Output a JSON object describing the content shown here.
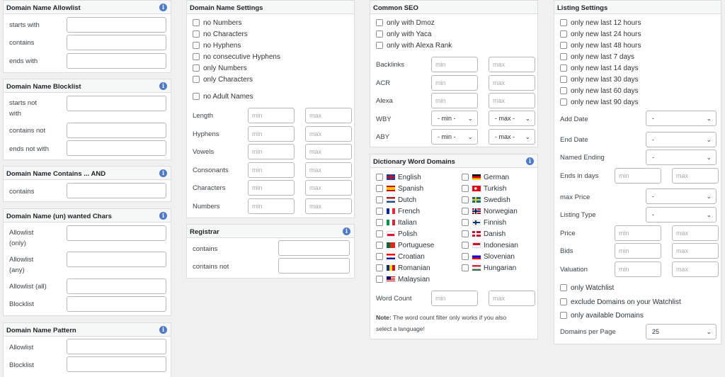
{
  "allowlist": {
    "title": "Domain Name Allowlist",
    "starts": "starts with",
    "contains": "contains",
    "ends": "ends with"
  },
  "blocklist": {
    "title": "Domain Name Blocklist",
    "starts_a": "starts not",
    "starts_b": "with",
    "contains": "contains not",
    "ends": "ends not with"
  },
  "contains_and": {
    "title": "Domain Name Contains ... AND",
    "contains": "contains"
  },
  "wanted_chars": {
    "title": "Domain Name (un) wanted Chars",
    "allow_only_a": "Allowlist",
    "allow_only_b": "(only)",
    "allow_any_a": "Allowlist",
    "allow_any_b": "(any)",
    "allow_all": "Allowlist (all)",
    "block": "Blocklist"
  },
  "pattern": {
    "title": "Domain Name Pattern",
    "allow": "Allowlist",
    "block": "Blocklist"
  },
  "settings": {
    "title": "Domain Name Settings",
    "checks": [
      "no Numbers",
      "no Characters",
      "no Hyphens",
      "no consecutive Hyphens",
      "only Numbers",
      "only Characters"
    ],
    "adult": "no Adult Names",
    "ranges": [
      "Length",
      "Hyphens",
      "Vowels",
      "Consonants",
      "Characters",
      "Numbers"
    ]
  },
  "registrar": {
    "title": "Registrar",
    "contains": "contains",
    "contains_not": "contains not"
  },
  "seo": {
    "title": "Common SEO",
    "checks": [
      "only with Dmoz",
      "only with Yaca",
      "only with Alexa Rank"
    ],
    "ranges": [
      "Backlinks",
      "ACR",
      "Alexa"
    ],
    "selects": [
      "WBY",
      "ABY"
    ],
    "min_opt": "- min -",
    "max_opt": "- max -"
  },
  "dictionary": {
    "title": "Dictionary Word Domains",
    "left": [
      "English",
      "Spanish",
      "Dutch",
      "French",
      "Italian",
      "Polish",
      "Portuguese",
      "Croatian",
      "Romanian",
      "Malaysian"
    ],
    "right": [
      "German",
      "Turkish",
      "Swedish",
      "Norwegian",
      "Finnish",
      "Danish",
      "Indonesian",
      "Slovenian",
      "Hungarian"
    ],
    "word_count": "Word Count",
    "note_bold": "Note:",
    "note_a": "The word count filter only works if you also",
    "note_b": "select a language!"
  },
  "listing": {
    "title": "Listing Settings",
    "checks": [
      "only new last 12 hours",
      "only new last 24 hours",
      "only new last 48 hours",
      "only new last 7 days",
      "only new last 14 days",
      "only new last 30 days",
      "only new last 60 days",
      "only new last 90 days"
    ],
    "add_date": "Add Date",
    "end_date": "End Date",
    "named_ending": "Named Ending",
    "ends_in_days": "Ends in days",
    "max_price": "max Price",
    "listing_type": "Listing Type",
    "price": "Price",
    "bids": "Bids",
    "valuation": "Valuation",
    "dash": "-",
    "watchlist": "only Watchlist",
    "exclude_watchlist": "exclude Domains on your Watchlist",
    "available": "only available Domains",
    "per_page": "Domains per Page",
    "per_page_value": "25"
  },
  "ph": {
    "min": "min",
    "max": "max"
  },
  "info_glyph": "i",
  "chevron": "⌄"
}
